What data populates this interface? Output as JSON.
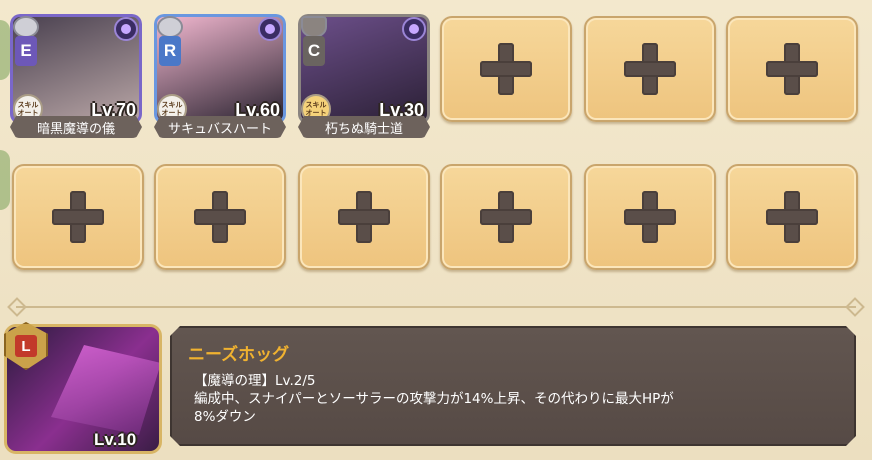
{
  "party": {
    "members": [
      {
        "rarity": "E",
        "rarity_color": "#6d58b8",
        "level": "Lv.70",
        "skill_badge": "スキル\nオート",
        "name": "暗黒魔導の儀",
        "art_colors": [
          "#4a4150",
          "#b9a6a6"
        ]
      },
      {
        "rarity": "R",
        "rarity_color": "#4a78c8",
        "level": "Lv.60",
        "skill_badge": "スキル\nオート",
        "name": "サキュバスハート",
        "art_colors": [
          "#f1b7cf",
          "#2a2330"
        ]
      },
      {
        "rarity": "C",
        "rarity_color": "#6a6460",
        "level": "Lv.30",
        "skill_badge": "スキル\nオート",
        "name": "朽ちぬ騎士道",
        "art_colors": [
          "#6c4f8a",
          "#2b2035"
        ]
      }
    ],
    "empty_slots": 9
  },
  "leader": {
    "rarity": "L",
    "level": "Lv.10",
    "name": "ニーズホッグ",
    "skill_line": "【魔導の理】Lv.2/5",
    "description_1": "編成中、スナイパーとソーサラーの攻撃力が14%上昇、その代わりに最大HPが",
    "description_2": "8%ダウン"
  },
  "icons": {
    "empty_slot": "plus-icon",
    "attribute": "dark-attribute-icon"
  }
}
